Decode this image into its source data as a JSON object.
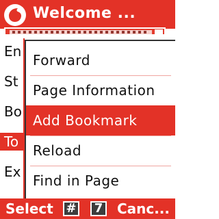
{
  "window": {
    "title": "Welcome ..."
  },
  "background_menu": {
    "items": [
      {
        "label": "En"
      },
      {
        "label": "St"
      },
      {
        "label": "Bo"
      },
      {
        "label": "To"
      },
      {
        "label": "Ex"
      }
    ],
    "selected_index": 3
  },
  "popup_menu": {
    "items": [
      {
        "label": "Forward"
      },
      {
        "label": "Page Information"
      },
      {
        "label": "Add Bookmark"
      },
      {
        "label": "Reload"
      },
      {
        "label": "Find in Page"
      }
    ],
    "selected_index": 2
  },
  "softkeys": {
    "left": "Select",
    "center_keys": [
      "#",
      "7"
    ],
    "right": "Canc..."
  },
  "colors": {
    "accent": "#e33227",
    "background": "#ffffff",
    "text": "#111111"
  },
  "icons": {
    "logo": "vodafone-logo-icon"
  }
}
